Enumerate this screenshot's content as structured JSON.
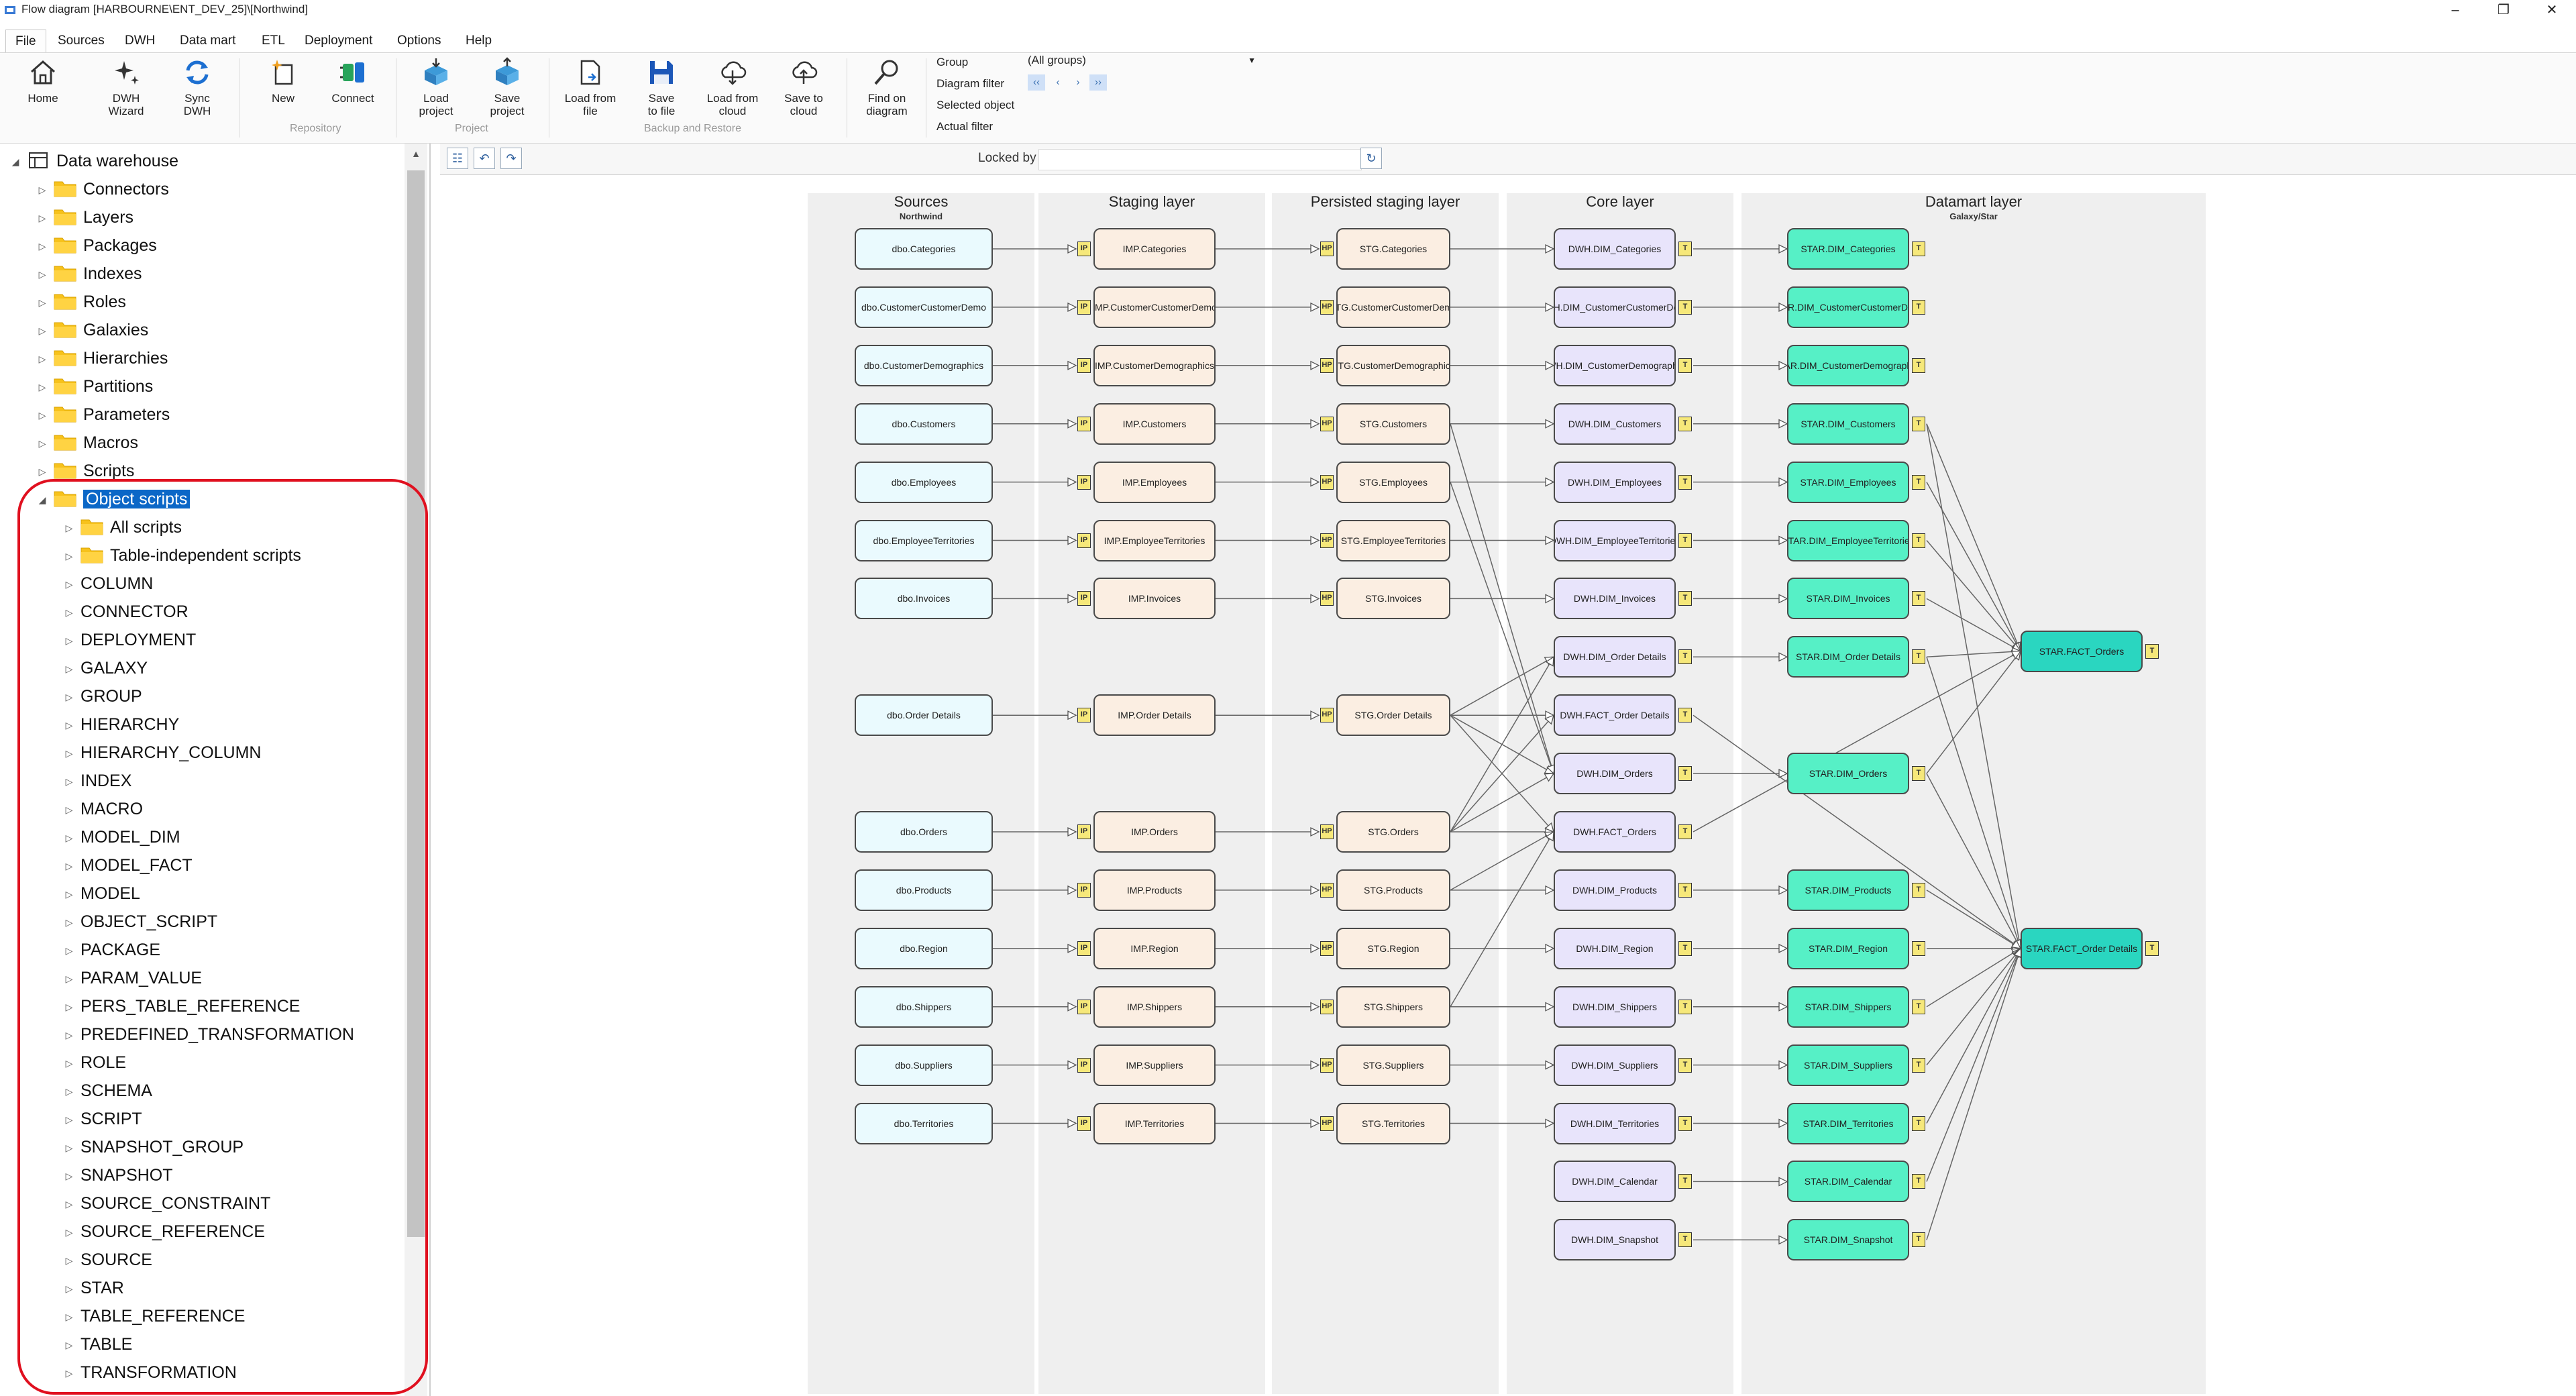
{
  "window": {
    "title": "Flow diagram    [HARBOURNE\\ENT_DEV_25]\\[Northwind]",
    "controls": [
      "–",
      "❐",
      "✕"
    ]
  },
  "menu": [
    "File",
    "Sources",
    "DWH",
    "Data mart",
    "ETL",
    "Deployment",
    "Options",
    "Help"
  ],
  "ribbon": {
    "buttons": {
      "home": "Home",
      "dwh_wizard": "DWH\nWizard",
      "sync_dwh": "Sync\nDWH",
      "new": "New",
      "connect": "Connect",
      "load_project": "Load\nproject",
      "save_project": "Save\nproject",
      "load_file": "Load from\nfile",
      "save_file": "Save\nto file",
      "load_cloud": "Load from\ncloud",
      "save_cloud": "Save to\ncloud",
      "find_diagram": "Find on\ndiagram"
    },
    "groups": {
      "repository": "Repository",
      "project": "Project",
      "backup": "Backup and Restore"
    },
    "labels": {
      "group": "Group",
      "diagram_filter": "Diagram filter",
      "selected_object": "Selected object",
      "actual_filter": "Actual filter"
    },
    "group_value": "(All groups)",
    "filter_nav": [
      "‹‹",
      "‹",
      "›",
      "››"
    ]
  },
  "tree": {
    "root": "Data warehouse",
    "folders": [
      "Connectors",
      "Layers",
      "Packages",
      "Indexes",
      "Roles",
      "Galaxies",
      "Hierarchies",
      "Partitions",
      "Parameters",
      "Macros",
      "Scripts"
    ],
    "selected": "Object scripts",
    "subfolders": [
      "All scripts",
      "Table-independent scripts"
    ],
    "items": [
      "COLUMN",
      "CONNECTOR",
      "DEPLOYMENT",
      "GALAXY",
      "GROUP",
      "HIERARCHY",
      "HIERARCHY_COLUMN",
      "INDEX",
      "MACRO",
      "MODEL_DIM",
      "MODEL_FACT",
      "MODEL",
      "OBJECT_SCRIPT",
      "PACKAGE",
      "PARAM_VALUE",
      "PERS_TABLE_REFERENCE",
      "PREDEFINED_TRANSFORMATION",
      "ROLE",
      "SCHEMA",
      "SCRIPT",
      "SNAPSHOT_GROUP",
      "SNAPSHOT",
      "SOURCE_CONSTRAINT",
      "SOURCE_REFERENCE",
      "SOURCE",
      "STAR",
      "TABLE_REFERENCE",
      "TABLE",
      "TRANSFORMATION"
    ]
  },
  "canvas": {
    "locked_label": "Locked by",
    "lanes": [
      {
        "title": "Sources",
        "subtitle": "Northwind"
      },
      {
        "title": "Staging layer",
        "subtitle": ""
      },
      {
        "title": "Persisted staging layer",
        "subtitle": ""
      },
      {
        "title": "Core layer",
        "subtitle": ""
      },
      {
        "title": "Datamart layer",
        "subtitle": "Galaxy/Star"
      }
    ],
    "colors": {
      "source": "#eafafe",
      "staging": "#fbeee2",
      "core": "#e8e4fb",
      "mart": "#56f0c6",
      "fact": "#2ad6c0",
      "badge": "#f6e87a"
    },
    "rows": [
      {
        "src": "dbo.Categories",
        "imp": "IMP.Categories",
        "stg": "STG.Categories",
        "dwh": "DWH.DIM_Categories",
        "star": "STAR.DIM_Categories"
      },
      {
        "src": "dbo.CustomerCustomerDemo",
        "imp": "IMP.CustomerCustomerDemo",
        "stg": "STG.CustomerCustomerDemo",
        "dwh": "DWH.DIM_CustomerCustomerDemo",
        "star": "STAR.DIM_CustomerCustomerDemo"
      },
      {
        "src": "dbo.CustomerDemographics",
        "imp": "IMP.CustomerDemographics",
        "stg": "STG.CustomerDemographics",
        "dwh": "DWH.DIM_CustomerDemographics",
        "star": "STAR.DIM_CustomerDemographics"
      },
      {
        "src": "dbo.Customers",
        "imp": "IMP.Customers",
        "stg": "STG.Customers",
        "dwh": "DWH.DIM_Customers",
        "star": "STAR.DIM_Customers"
      },
      {
        "src": "dbo.Employees",
        "imp": "IMP.Employees",
        "stg": "STG.Employees",
        "dwh": "DWH.DIM_Employees",
        "star": "STAR.DIM_Employees"
      },
      {
        "src": "dbo.EmployeeTerritories",
        "imp": "IMP.EmployeeTerritories",
        "stg": "STG.EmployeeTerritories",
        "dwh": "DWH.DIM_EmployeeTerritories",
        "star": "STAR.DIM_EmployeeTerritories"
      },
      {
        "src": "dbo.Invoices",
        "imp": "IMP.Invoices",
        "stg": "STG.Invoices",
        "dwh": "DWH.DIM_Invoices",
        "star": "STAR.DIM_Invoices"
      },
      {
        "src": "",
        "imp": "",
        "stg": "",
        "dwh": "DWH.DIM_Order Details",
        "star": "STAR.DIM_Order Details"
      },
      {
        "src": "dbo.Order Details",
        "imp": "IMP.Order Details",
        "stg": "STG.Order Details",
        "dwh": "DWH.FACT_Order Details",
        "star": ""
      },
      {
        "src": "",
        "imp": "",
        "stg": "",
        "dwh": "DWH.DIM_Orders",
        "star": "STAR.DIM_Orders"
      },
      {
        "src": "dbo.Orders",
        "imp": "IMP.Orders",
        "stg": "STG.Orders",
        "dwh": "DWH.FACT_Orders",
        "star": ""
      },
      {
        "src": "dbo.Products",
        "imp": "IMP.Products",
        "stg": "STG.Products",
        "dwh": "DWH.DIM_Products",
        "star": "STAR.DIM_Products"
      },
      {
        "src": "dbo.Region",
        "imp": "IMP.Region",
        "stg": "STG.Region",
        "dwh": "DWH.DIM_Region",
        "star": "STAR.DIM_Region"
      },
      {
        "src": "dbo.Shippers",
        "imp": "IMP.Shippers",
        "stg": "STG.Shippers",
        "dwh": "DWH.DIM_Shippers",
        "star": "STAR.DIM_Shippers"
      },
      {
        "src": "dbo.Suppliers",
        "imp": "IMP.Suppliers",
        "stg": "STG.Suppliers",
        "dwh": "DWH.DIM_Suppliers",
        "star": "STAR.DIM_Suppliers"
      },
      {
        "src": "dbo.Territories",
        "imp": "IMP.Territories",
        "stg": "STG.Territories",
        "dwh": "DWH.DIM_Territories",
        "star": "STAR.DIM_Territories"
      },
      {
        "src": "",
        "imp": "",
        "stg": "",
        "dwh": "DWH.DIM_Calendar",
        "star": "STAR.DIM_Calendar"
      },
      {
        "src": "",
        "imp": "",
        "stg": "",
        "dwh": "DWH.DIM_Snapshot",
        "star": "STAR.DIM_Snapshot"
      }
    ],
    "facts": [
      "STAR.FACT_Orders",
      "STAR.FACT_Order Details"
    ],
    "badges": {
      "imp": "IP",
      "stg": "HP",
      "dwh": "T",
      "star": "T",
      "fact": "T"
    }
  }
}
